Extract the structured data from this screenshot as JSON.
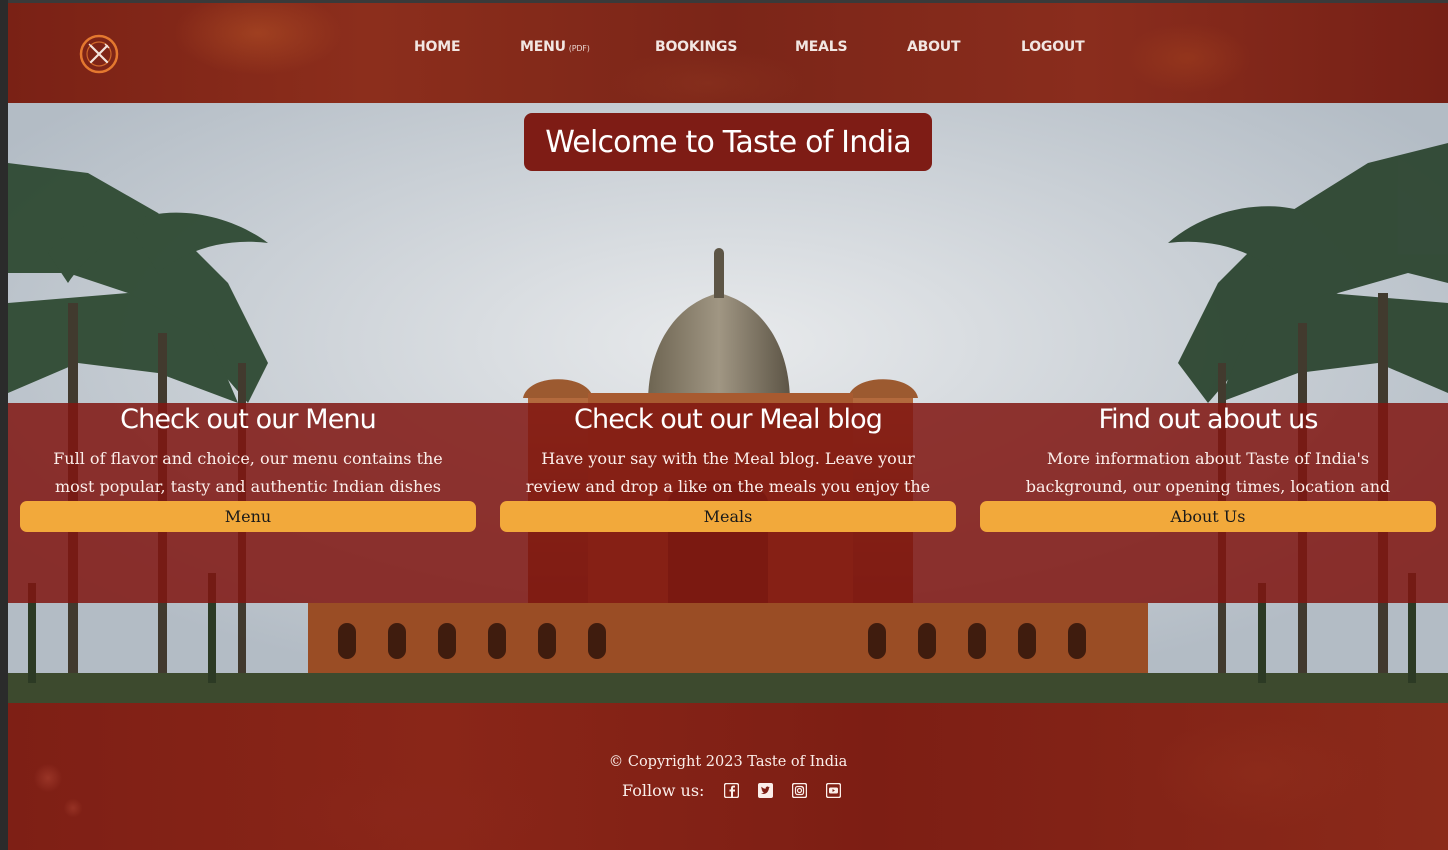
{
  "nav": {
    "items": [
      {
        "label": "HOME",
        "sub": ""
      },
      {
        "label": "MENU",
        "sub": "(PDF)"
      },
      {
        "label": "BOOKINGS",
        "sub": ""
      },
      {
        "label": "MEALS",
        "sub": ""
      },
      {
        "label": "ABOUT",
        "sub": ""
      },
      {
        "label": "LOGOUT",
        "sub": ""
      }
    ]
  },
  "hero": {
    "title": "Welcome to Taste of India"
  },
  "cards": [
    {
      "title": "Check out our Menu",
      "text": "Full of flavor and choice, our menu contains the most popular, tasty and authentic Indian dishes",
      "button": "Menu"
    },
    {
      "title": "Check out our Meal blog",
      "text": "Have your say with the Meal blog. Leave your review and drop a like on the meals you enjoy the most.",
      "button": "Meals"
    },
    {
      "title": "Find out about us",
      "text": "More information about Taste of India's background, our opening times, location and contact details",
      "button": "About Us"
    }
  ],
  "footer": {
    "copyright": "© Copyright 2023 Taste of India",
    "follow_label": "Follow us:",
    "social_icons": [
      "facebook-icon",
      "twitter-icon",
      "instagram-icon",
      "youtube-icon"
    ]
  },
  "colors": {
    "brand_red": "#7e1c15",
    "button_orange": "#f2a93b",
    "logo_orange": "#e4782f"
  }
}
